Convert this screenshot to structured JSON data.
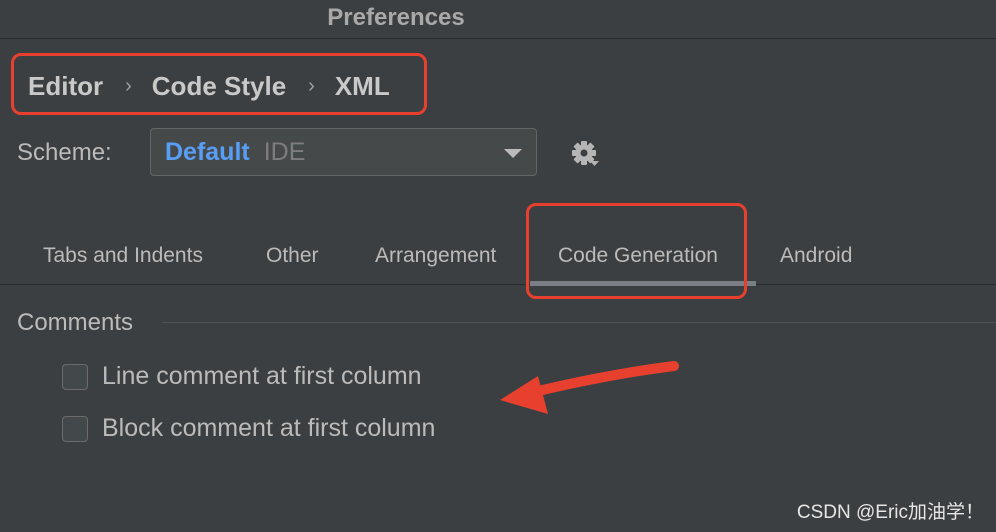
{
  "window": {
    "title": "Preferences"
  },
  "breadcrumb": {
    "items": [
      "Editor",
      "Code Style",
      "XML"
    ],
    "separator": "›"
  },
  "scheme": {
    "label": "Scheme:",
    "name": "Default",
    "kind": "IDE"
  },
  "tabs": [
    {
      "label": "Tabs and Indents"
    },
    {
      "label": "Other"
    },
    {
      "label": "Arrangement"
    },
    {
      "label": "Code Generation",
      "selected": true
    },
    {
      "label": "Android"
    }
  ],
  "comments": {
    "title": "Comments",
    "options": [
      {
        "label": "Line comment at first column",
        "checked": false
      },
      {
        "label": "Block comment at first column",
        "checked": false
      }
    ]
  },
  "watermark": "CSDN @Eric加油学！",
  "colors": {
    "highlight": "#e8402f",
    "accent": "#589df6",
    "background": "#3c3f41"
  },
  "icons": {
    "settings": "gear-icon",
    "dropdown": "chevron-down-icon",
    "annotation": "arrow-annotation"
  }
}
